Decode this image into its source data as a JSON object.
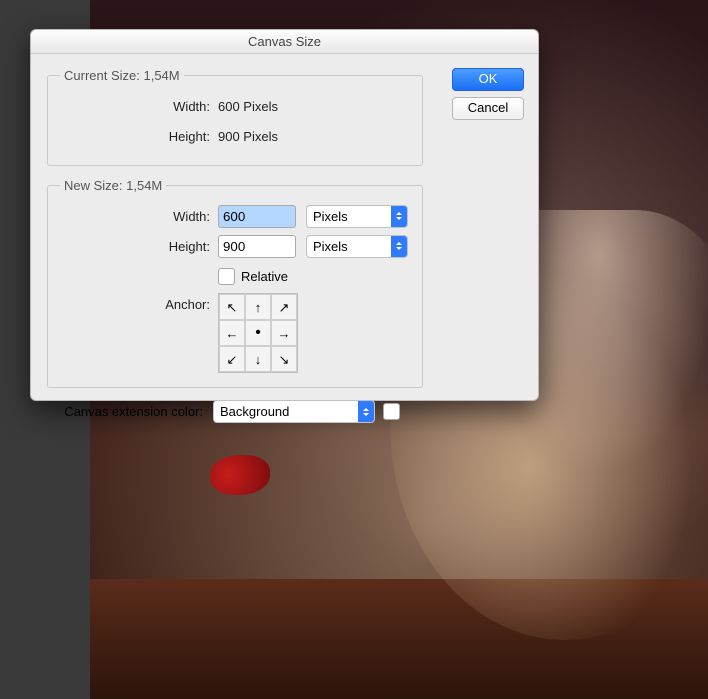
{
  "dialog": {
    "title": "Canvas Size",
    "buttons": {
      "ok": "OK",
      "cancel": "Cancel"
    },
    "current": {
      "legend": "Current Size: 1,54M",
      "width_label": "Width:",
      "width_value": "600 Pixels",
      "height_label": "Height:",
      "height_value": "900 Pixels"
    },
    "new": {
      "legend": "New Size: 1,54M",
      "width_label": "Width:",
      "width_value": "600",
      "width_unit": "Pixels",
      "height_label": "Height:",
      "height_value": "900",
      "height_unit": "Pixels",
      "relative_label": "Relative",
      "anchor_label": "Anchor:"
    },
    "extension": {
      "label": "Canvas extension color:",
      "value": "Background"
    }
  }
}
